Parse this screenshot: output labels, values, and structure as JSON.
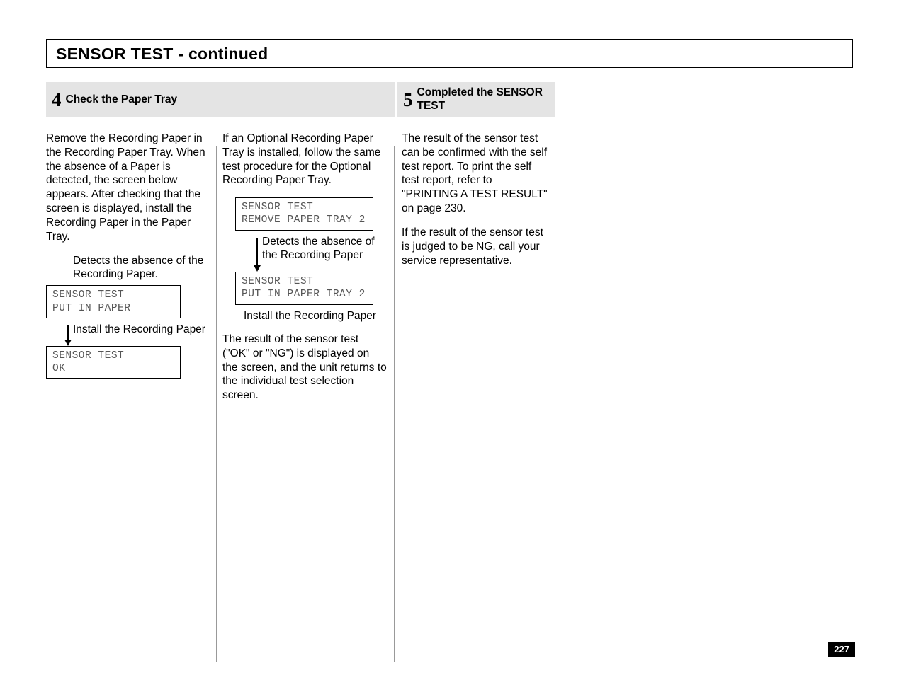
{
  "title": "SENSOR TEST - continued",
  "step4": {
    "num": "4",
    "title": "Check the Paper Tray",
    "colA": {
      "para1": "Remove the Recording Paper in the Recording Paper Tray. When the absence of a Paper is detected, the screen below appears. After checking that the screen is displayed, install the Recording Paper in the Paper Tray.",
      "cap1": "Detects  the absence of the Recording Paper.",
      "lcd1_l1": "SENSOR TEST",
      "lcd1_l2": "PUT IN PAPER",
      "cap2": "Install the Recording Paper",
      "lcd2_l1": "SENSOR TEST",
      "lcd2_l2": "OK"
    },
    "colB": {
      "para1": "If an Optional Recording Paper Tray is installed, follow the same test procedure for the Optional Recording Paper Tray.",
      "lcd1_l1": "SENSOR TEST",
      "lcd1_l2": "REMOVE PAPER TRAY 2",
      "cap1": "Detects the absence of the Recording Paper",
      "lcd2_l1": "SENSOR TEST",
      "lcd2_l2": "PUT IN PAPER TRAY 2",
      "cap2": "Install the Recording Paper",
      "para2": "The result of the sensor test (\"OK\" or \"NG\") is displayed on the screen, and the unit returns to the individual test selection screen."
    }
  },
  "step5": {
    "num": "5",
    "title": "Completed the SENSOR TEST",
    "para1": "The result of the sensor test can be confirmed with the self test report. To print the self test report, refer to \"PRINTING A TEST RESULT\" on page 230.",
    "para2": "If the result of the sensor test is judged to be NG, call your service  representative."
  },
  "page": "227"
}
